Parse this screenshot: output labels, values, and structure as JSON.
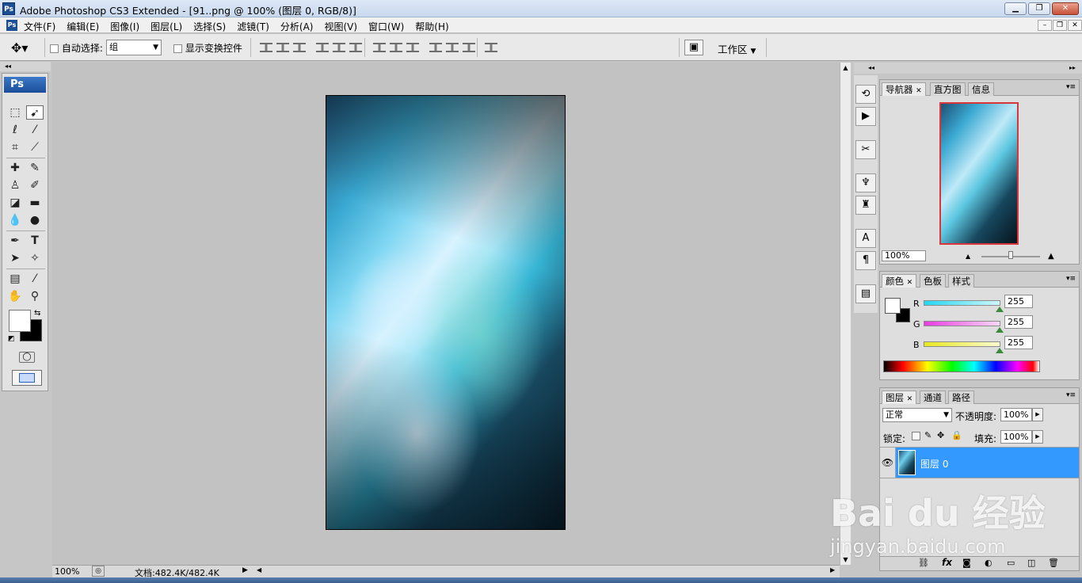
{
  "window": {
    "title": "Adobe Photoshop CS3 Extended - [91..png @ 100% (图层 0, RGB/8)]",
    "app_badge": "Ps"
  },
  "menu": {
    "items": [
      "文件(F)",
      "编辑(E)",
      "图像(I)",
      "图层(L)",
      "选择(S)",
      "滤镜(T)",
      "分析(A)",
      "视图(V)",
      "窗口(W)",
      "帮助(H)"
    ]
  },
  "options": {
    "auto_select_label": "自动选择:",
    "auto_select_value": "组",
    "show_transform_label": "显示变换控件",
    "workspace_label": "工作区"
  },
  "toolbox": {
    "badge": "Ps"
  },
  "status": {
    "zoom": "100%",
    "doc_info": "文档:482.4K/482.4K"
  },
  "navigator": {
    "tabs": [
      "导航器",
      "直方图",
      "信息"
    ],
    "zoom": "100%"
  },
  "color_panel": {
    "tabs": [
      "颜色",
      "色板",
      "样式"
    ],
    "channels": [
      {
        "label": "R",
        "value": "255",
        "color": "#22d7f0"
      },
      {
        "label": "G",
        "value": "255",
        "color": "#e73be0"
      },
      {
        "label": "B",
        "value": "255",
        "color": "#e8e820"
      }
    ]
  },
  "layers_panel": {
    "tabs": [
      "图层",
      "通道",
      "路径"
    ],
    "blend_mode": "正常",
    "opacity_label": "不透明度:",
    "opacity_value": "100%",
    "lock_label": "锁定:",
    "fill_label": "填充:",
    "fill_value": "100%",
    "layer_name": "图层 0",
    "selection_color": "#3399ff"
  },
  "watermark": {
    "logo_text": "Bai du 经验",
    "url": "jingyan.baidu.com"
  }
}
